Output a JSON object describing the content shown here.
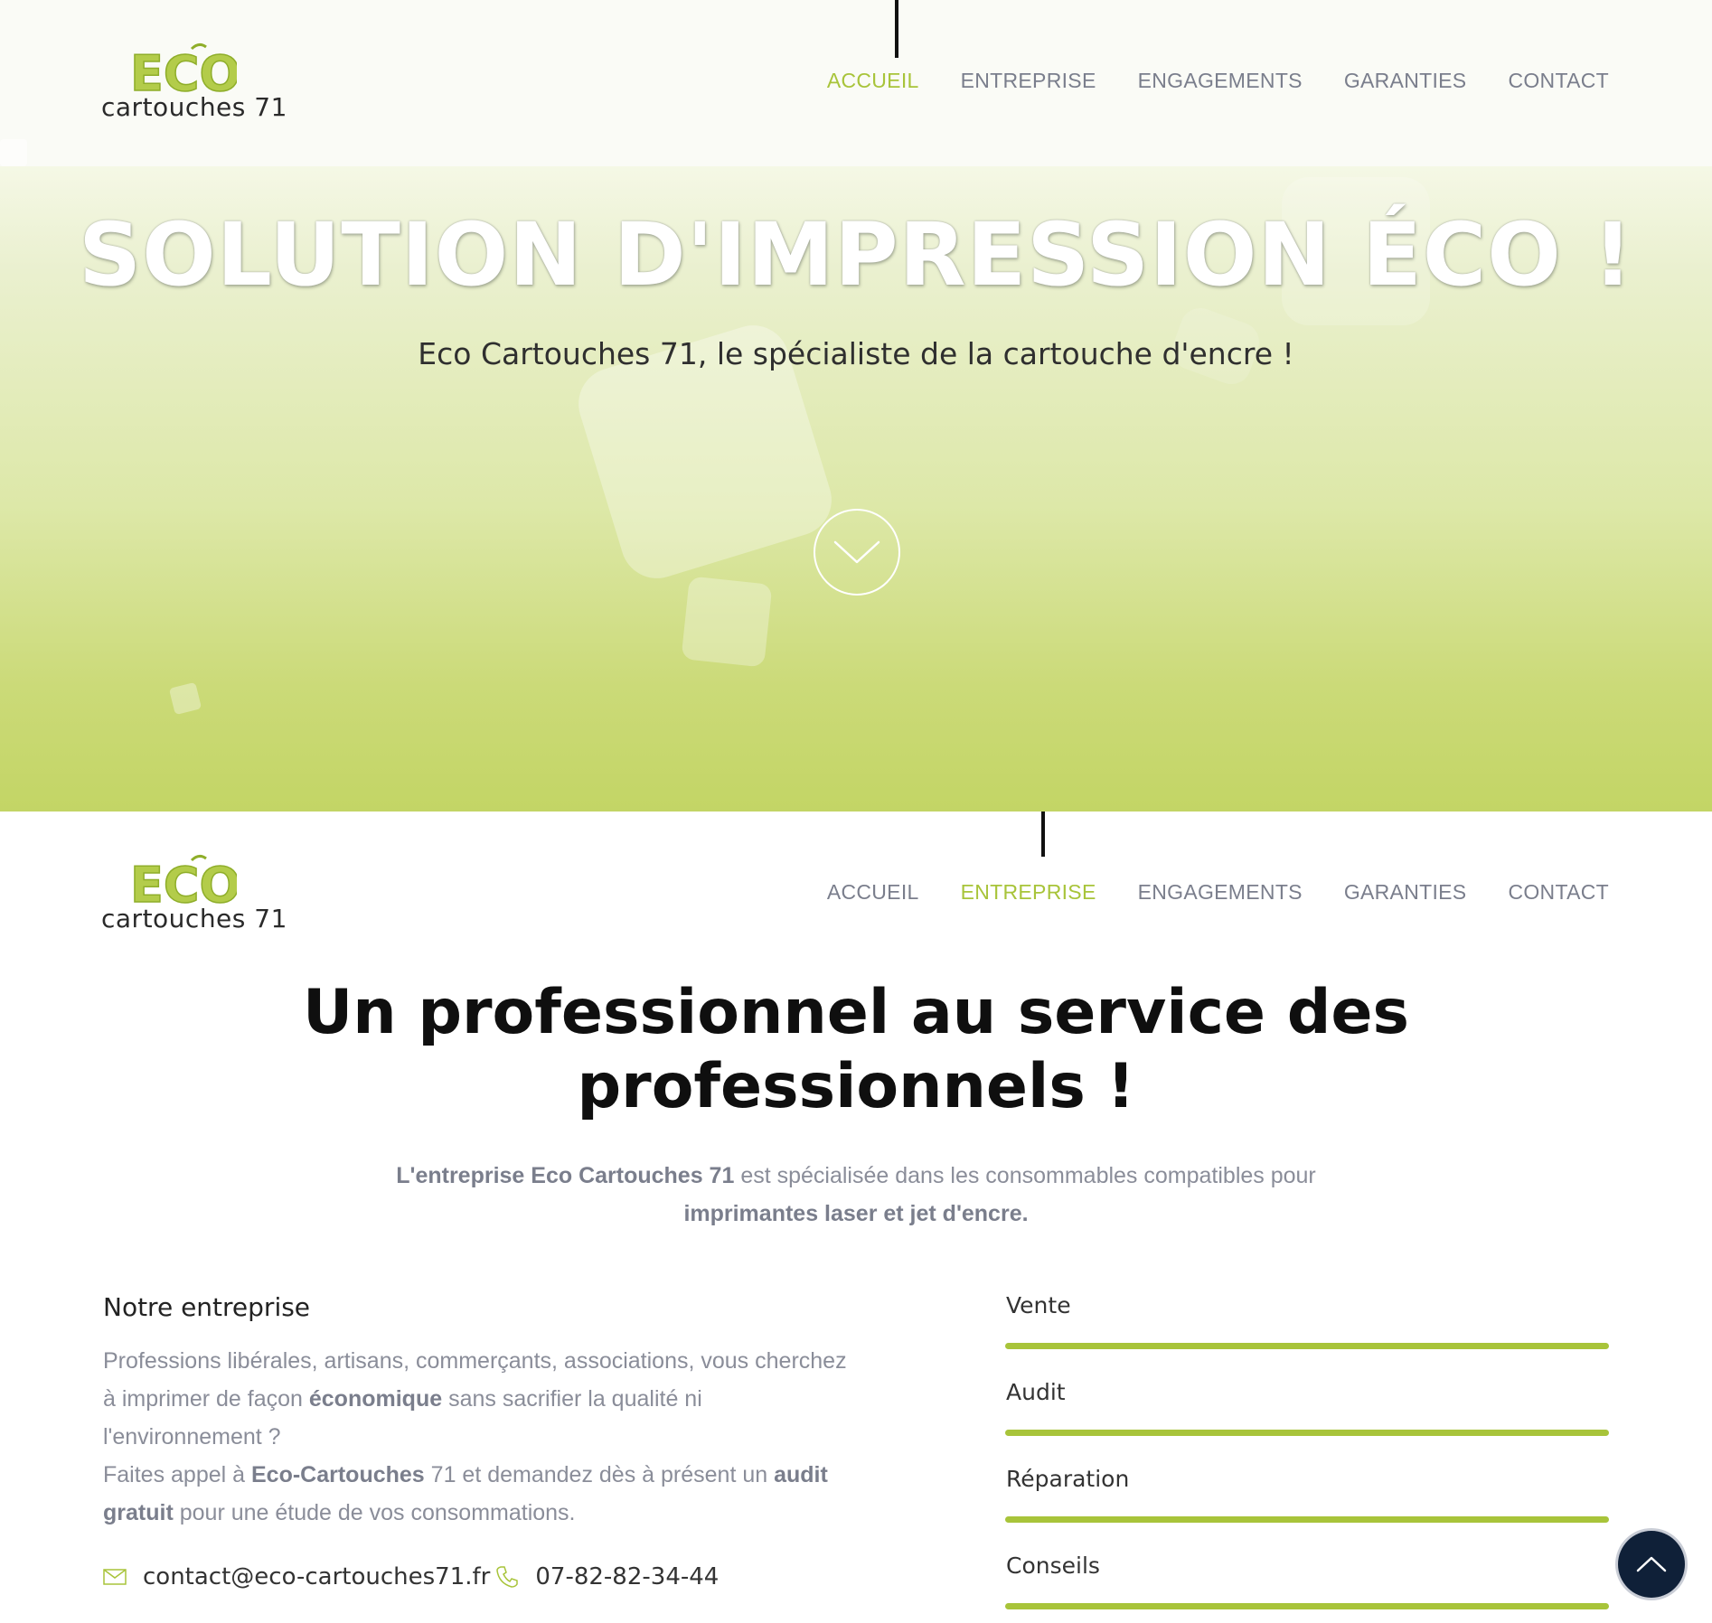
{
  "brand": {
    "logo_eco": "ECO",
    "logo_line": "cartouches 71"
  },
  "nav": {
    "items": [
      "ACCUEIL",
      "ENTREPRISE",
      "ENGAGEMENTS",
      "GARANTIES",
      "CONTACT"
    ],
    "active_top": "ACCUEIL",
    "active_second": "ENTREPRISE"
  },
  "hero": {
    "title": "SOLUTION D'IMPRESSION ÉCO !",
    "subtitle": "Eco Cartouches 71, le spécialiste de la cartouche d'encre !",
    "scroll_icon": "chevron-down-icon"
  },
  "section": {
    "title_line1": "Un professionnel au service des",
    "title_line2": "professionnels !",
    "intro_bold1": "L'entreprise Eco Cartouches 71",
    "intro_text": " est spécialisée dans les consommables compatibles pour",
    "intro_bold2": "imprimantes laser et jet d'encre."
  },
  "company": {
    "heading": "Notre entreprise",
    "p1_a": "Professions libérales, artisans, commerçants, associations, vous cherchez à imprimer de façon ",
    "p1_bold": "économique",
    "p1_b": " sans sacrifier la qualité ni l'environnement ?",
    "p2_a": "Faites appel à ",
    "p2_bold1": "Eco-Cartouches",
    "p2_b": " 71 et demandez dès à présent un ",
    "p2_bold2": "audit gratuit",
    "p2_c": " pour une étude de vos consommations.",
    "email": "contact@eco-cartouches71.fr",
    "phone": "07-82-82-34-44",
    "email_icon": "envelope-icon",
    "phone_icon": "phone-icon"
  },
  "skills": [
    {
      "label": "Vente",
      "level": 1.0
    },
    {
      "label": "Audit",
      "level": 1.0
    },
    {
      "label": "Réparation",
      "level": 1.0
    },
    {
      "label": "Conseils",
      "level": 1.0
    }
  ],
  "colors": {
    "accent": "#a8c43a",
    "nav_text": "#7a7e8c",
    "to_top_bg": "#0f2038"
  },
  "to_top_icon": "chevron-up-icon"
}
